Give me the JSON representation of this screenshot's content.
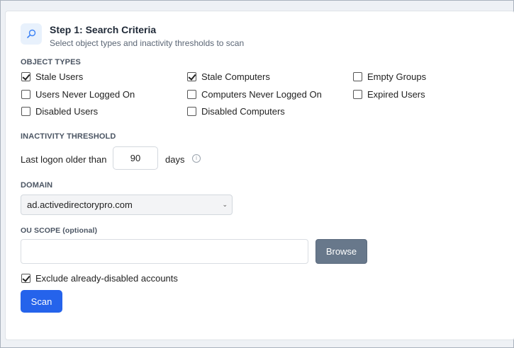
{
  "step": {
    "title": "Step 1: Search Criteria",
    "subtitle": "Select object types and inactivity thresholds to scan",
    "icon": "search-icon"
  },
  "object_types": {
    "label": "OBJECT TYPES",
    "options": [
      {
        "label": "Stale Users",
        "checked": true
      },
      {
        "label": "Stale Computers",
        "checked": true
      },
      {
        "label": "Empty Groups",
        "checked": false
      },
      {
        "label": "Users Never Logged On",
        "checked": false
      },
      {
        "label": "Computers Never Logged On",
        "checked": false
      },
      {
        "label": "Expired Users",
        "checked": false
      },
      {
        "label": "Disabled Users",
        "checked": false
      },
      {
        "label": "Disabled Computers",
        "checked": false
      }
    ]
  },
  "inactivity": {
    "label": "INACTIVITY THRESHOLD",
    "prefix": "Last logon older than",
    "value": "90",
    "suffix": "days"
  },
  "domain": {
    "label": "DOMAIN",
    "selected": "ad.activedirectorypro.com"
  },
  "ou_scope": {
    "label": "OU SCOPE (optional)",
    "value": "",
    "browse_label": "Browse"
  },
  "exclude_disabled": {
    "label": "Exclude already-disabled accounts",
    "checked": true
  },
  "scan_label": "Scan",
  "colors": {
    "primary": "#2563eb",
    "secondary_button": "#68788b",
    "icon_bg": "#e8f1fc"
  }
}
